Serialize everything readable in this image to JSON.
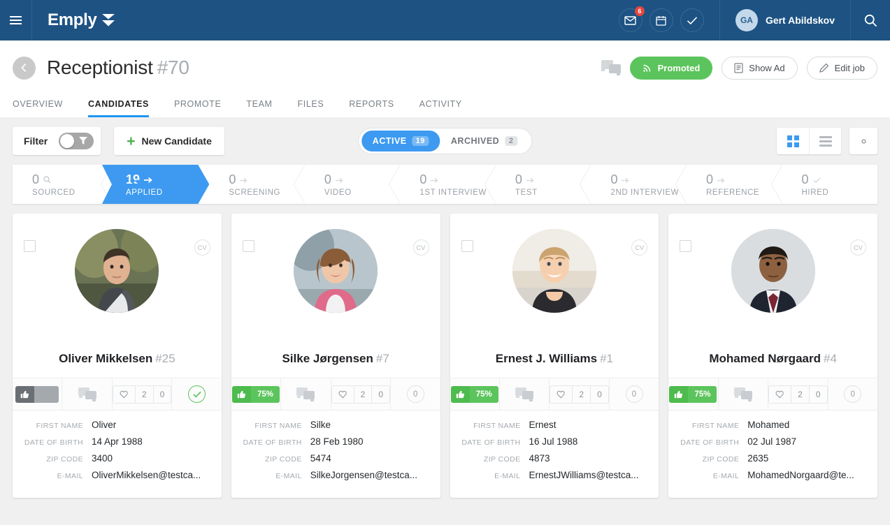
{
  "topnav": {
    "menu_icon": "hamburger-icon",
    "brand": "Emply",
    "mail_badge": "6",
    "user_initials": "GA",
    "user_name": "Gert Abildskov"
  },
  "header": {
    "title": "Receptionist",
    "job_number": "#70",
    "promoted_label": "Promoted",
    "show_ad_label": "Show Ad",
    "edit_job_label": "Edit job",
    "tabs": [
      {
        "label": "OVERVIEW",
        "active": false
      },
      {
        "label": "CANDIDATES",
        "active": true
      },
      {
        "label": "PROMOTE",
        "active": false
      },
      {
        "label": "TEAM",
        "active": false
      },
      {
        "label": "FILES",
        "active": false
      },
      {
        "label": "REPORTS",
        "active": false
      },
      {
        "label": "ACTIVITY",
        "active": false
      }
    ]
  },
  "toolbar": {
    "filter_label": "Filter",
    "filter_on": false,
    "new_candidate_label": "New Candidate",
    "segments": [
      {
        "label": "ACTIVE",
        "count": "19",
        "active": true
      },
      {
        "label": "ARCHIVED",
        "count": "2",
        "active": false
      }
    ]
  },
  "pipeline": [
    {
      "count": "0",
      "label": "SOURCED",
      "icon": "magnifier",
      "active": false
    },
    {
      "count": "19",
      "label": "APPLIED",
      "icon": "arrow",
      "active": true
    },
    {
      "count": "0",
      "label": "SCREENING",
      "icon": "arrow",
      "active": false
    },
    {
      "count": "0",
      "label": "VIDEO",
      "icon": "arrow",
      "active": false
    },
    {
      "count": "0",
      "label": "1ST INTERVIEW",
      "icon": "arrow",
      "active": false
    },
    {
      "count": "0",
      "label": "TEST",
      "icon": "arrow",
      "active": false
    },
    {
      "count": "0",
      "label": "2ND INTERVIEW",
      "icon": "arrow",
      "active": false
    },
    {
      "count": "0",
      "label": "REFERENCE",
      "icon": "arrow",
      "active": false
    },
    {
      "count": "0",
      "label": "HIRED",
      "icon": "check",
      "active": false
    }
  ],
  "detail_labels": {
    "first_name": "FIRST NAME",
    "date_of_birth": "DATE OF BIRTH",
    "zip_code": "ZIP CODE",
    "email": "E-MAIL"
  },
  "cv_label": "CV",
  "cards": [
    {
      "name": "Oliver Mikkelsen",
      "number": "#25",
      "rating": "",
      "rating_style": "gray",
      "likes": "2",
      "dislikes": "0",
      "trailing": "check",
      "trailing_count": "",
      "first_name": "Oliver",
      "date_of_birth": "14 Apr 1988",
      "zip_code": "3400",
      "email": "OliverMikkelsen@testca...",
      "photo": "male-outdoor-jacket"
    },
    {
      "name": "Silke Jørgensen",
      "number": "#7",
      "rating": "75%",
      "rating_style": "green",
      "likes": "2",
      "dislikes": "0",
      "trailing": "count",
      "trailing_count": "0",
      "first_name": "Silke",
      "date_of_birth": "28 Feb 1980",
      "zip_code": "5474",
      "email": "SilkeJorgensen@testca...",
      "photo": "female-pink-jacket"
    },
    {
      "name": "Ernest J. Williams",
      "number": "#1",
      "rating": "75%",
      "rating_style": "green",
      "likes": "2",
      "dislikes": "0",
      "trailing": "count",
      "trailing_count": "0",
      "first_name": "Ernest",
      "date_of_birth": "16 Jul 1988",
      "zip_code": "4873",
      "email": "ErnestJWilliams@testca...",
      "photo": "male-smiling-black-shirt"
    },
    {
      "name": "Mohamed Nørgaard",
      "number": "#4",
      "rating": "75%",
      "rating_style": "green",
      "likes": "2",
      "dislikes": "0",
      "trailing": "count",
      "trailing_count": "0",
      "first_name": "Mohamed",
      "date_of_birth": "02 Jul 1987",
      "zip_code": "2635",
      "email": "MohamedNorgaard@te...",
      "photo": "male-suit-tie"
    }
  ],
  "colors": {
    "nav_blue": "#1d5283",
    "accent_blue": "#3d9af0",
    "green": "#5cc45c",
    "badge_red": "#e8453c",
    "page_bg": "#f0f0f0"
  }
}
